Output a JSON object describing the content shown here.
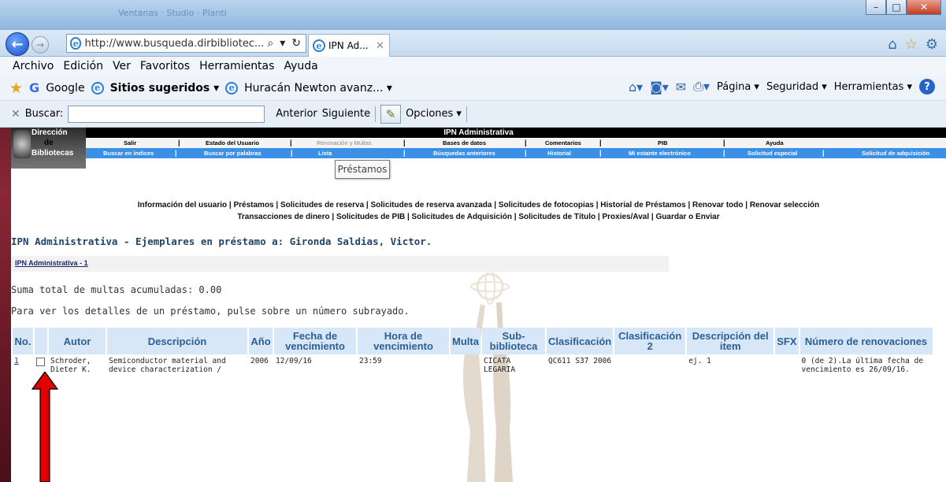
{
  "browser": {
    "ghost_title": "Ventanas · Studio · Planti",
    "url": "http://www.busqueda.dirbibliotec...",
    "tab_title": "IPN Ad...",
    "menu": [
      "Archivo",
      "Edición",
      "Ver",
      "Favoritos",
      "Herramientas",
      "Ayuda"
    ],
    "favorites": {
      "google": "Google",
      "suggested": "Sitios sugeridos ▾",
      "huracan": "Huracán Newton avanz... ▾"
    },
    "commands": {
      "page": "Página ▾",
      "security": "Seguridad ▾",
      "tools": "Herramientas ▾"
    },
    "find": {
      "label": "Buscar:",
      "prev": "Anterior",
      "next": "Siguiente",
      "options": "Opciones ▾"
    }
  },
  "site": {
    "logo": {
      "line1": "Dirección",
      "line2": "de",
      "line3": "Bibliotecas"
    },
    "institution": "IPN Administrativa",
    "nav_top": [
      "Salir",
      "Estado del Usuario",
      "Renovación y Multas",
      "Bases de datos",
      "Comentarios",
      "PIB",
      "Ayuda"
    ],
    "nav_bottom": [
      "Buscar en índices",
      "Buscar por palabras",
      "Lista",
      "Búsquedas anteriores",
      "Historial",
      "Mi estante electrónico",
      "Solicitud especial",
      "Solicitud de adquisición"
    ],
    "tooltip": "Préstamos",
    "sublinks_1": "Información del usuario | Préstamos | Solicitudes de reserva | Solicitudes de reserva avanzada | Solicitudes de fotocopias | Historial de Préstamos | Renovar todo | Renovar selección",
    "sublinks_2": "Transacciones de dinero | Solicitudes de PIB | Solicitudes de Adquisición | Solicitudes de Título | Proxies/Aval | Guardar o Enviar",
    "heading": "IPN Administrativa - Ejemplares en préstamo a: Gironda Saldias, Victor.",
    "library_link": "IPN Administrativa - 1",
    "fines": "Suma total de multas acumuladas: 0.00",
    "hint": "Para ver los detalles de un préstamo, pulse sobre un número subrayado."
  },
  "table": {
    "headers": [
      "No.",
      "",
      "Autor",
      "Descripción",
      "Año",
      "Fecha de vencimiento",
      "Hora de vencimiento",
      "Multa",
      "Sub-biblioteca",
      "Clasificación",
      "Clasificación 2",
      "Descripción del item",
      "SFX",
      "Número de renovaciones"
    ],
    "rows": [
      {
        "no": "1",
        "author": "Schroder, Dieter K.",
        "description": "Semiconductor material and device characterization /",
        "year": "2006",
        "due_date": "12/09/16",
        "due_time": "23:59",
        "fine": "",
        "sublibrary": "CICATA LEGARIA",
        "classification": "QC611 S37 2006",
        "classification2": "",
        "item_desc": "ej. 1",
        "sfx": "",
        "renewals": "0 (de 2).La última fecha de vencimiento es 26/09/16."
      }
    ]
  },
  "colors": {
    "header_bg": "#d7e7f8",
    "header_text": "#2b5f96",
    "nav_blue": "#3b8fe6",
    "arrow": "#e00000"
  }
}
